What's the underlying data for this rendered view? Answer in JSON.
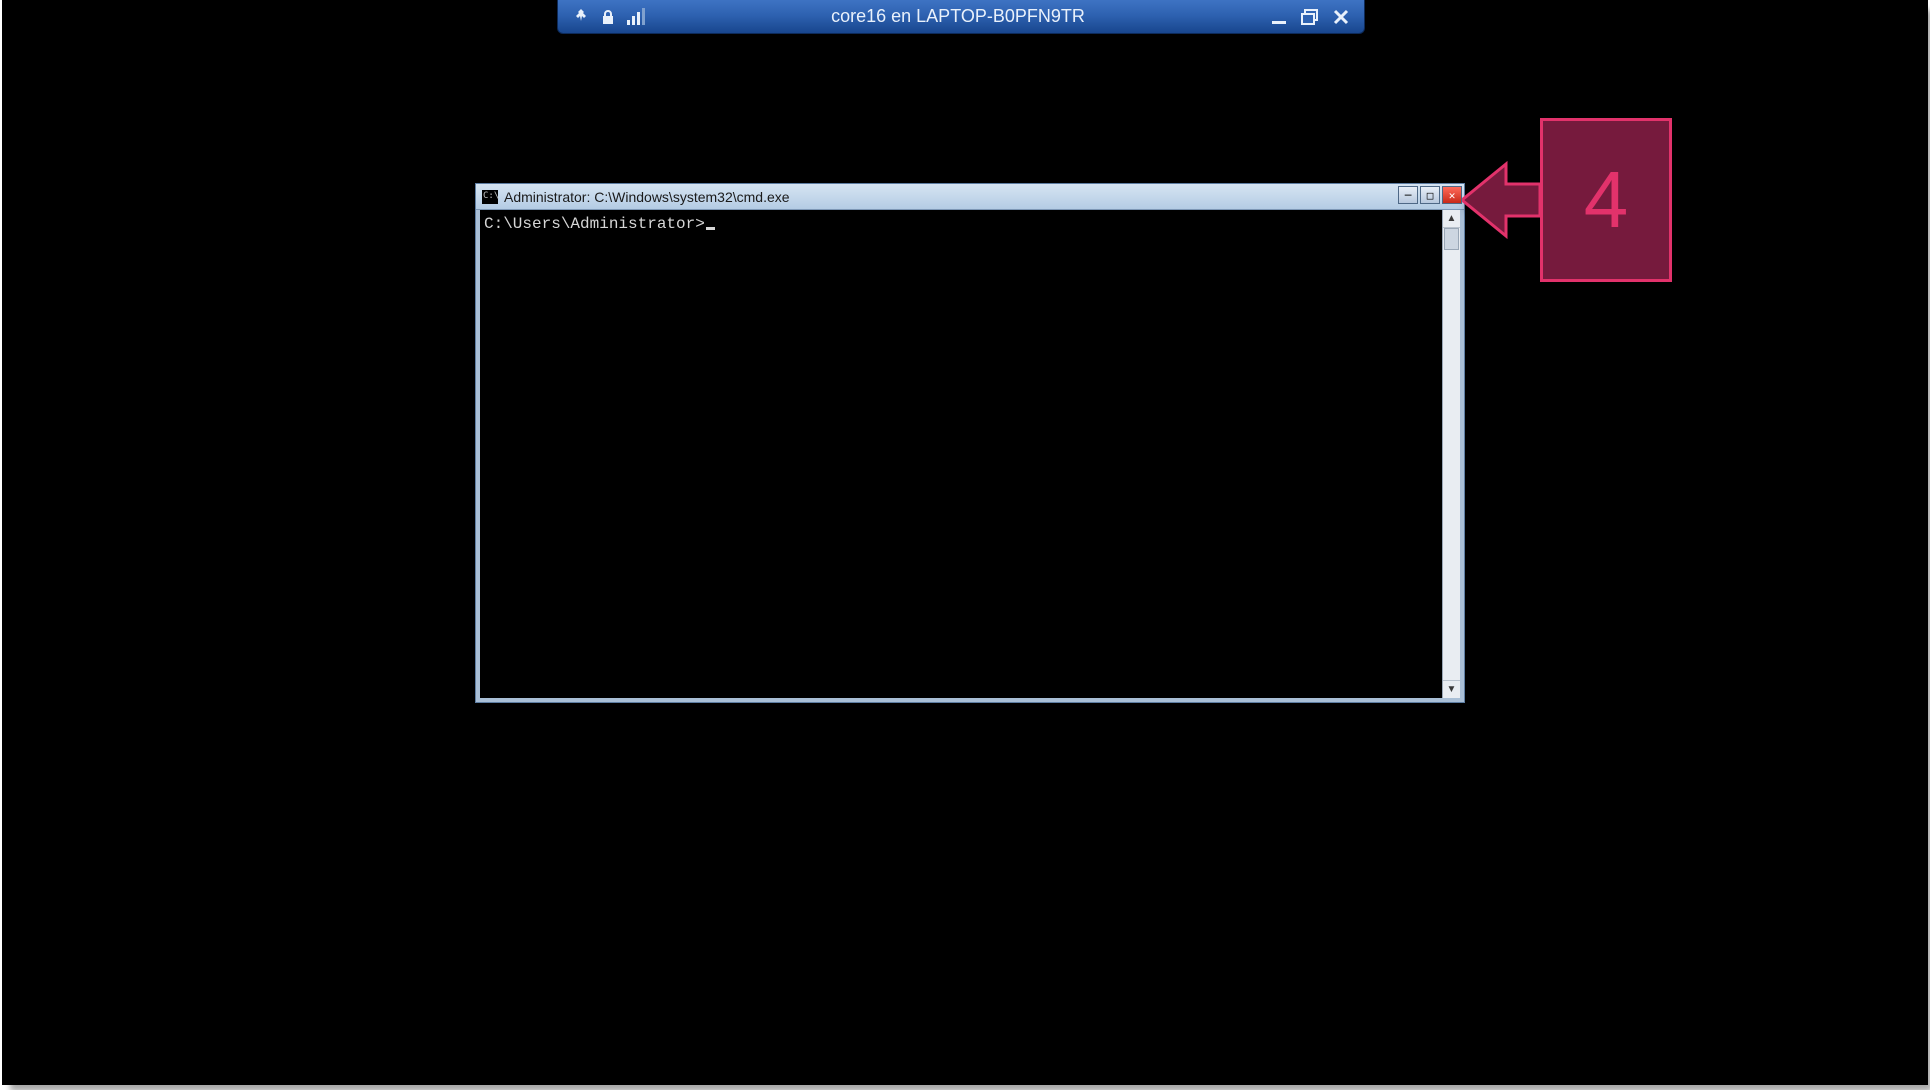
{
  "rdp_bar": {
    "title": "core16 en LAPTOP-B0PFN9TR",
    "icons": {
      "pin": "pin-icon",
      "lock": "lock-icon",
      "signal": "signal-icon",
      "minimize": "minimize-icon",
      "restore": "restore-icon",
      "close": "close-icon"
    }
  },
  "cmd": {
    "title": "Administrator: C:\\Windows\\system32\\cmd.exe",
    "prompt": "C:\\Users\\Administrator>",
    "buttons": {
      "minimize": "─",
      "maximize": "□",
      "close": "✕"
    }
  },
  "callout": {
    "number": "4",
    "colors": {
      "fill": "#761a3d",
      "stroke": "#e2326b"
    }
  }
}
